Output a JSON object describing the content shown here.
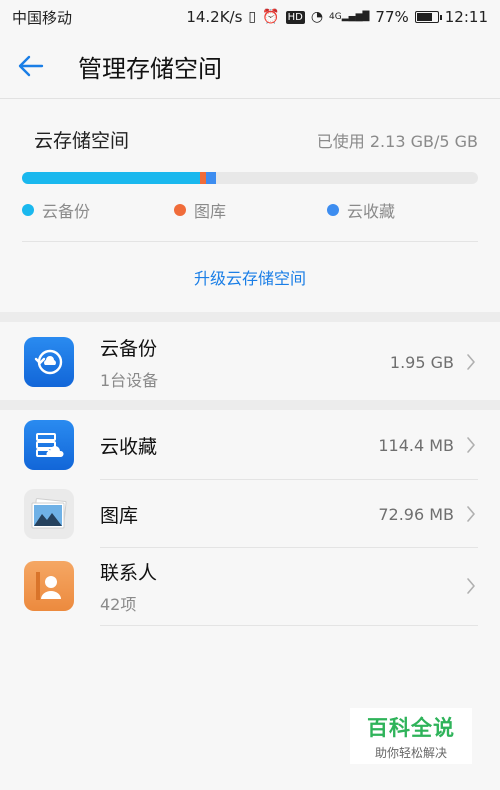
{
  "status_bar": {
    "carrier": "中国移动",
    "speed": "14.2K/s",
    "hd": "HD",
    "signal": "4G",
    "battery": "77%",
    "time": "12:11"
  },
  "header": {
    "title": "管理存储空间"
  },
  "storage": {
    "title": "云存储空间",
    "usage": "已使用 2.13 GB/5 GB",
    "used_fraction": 0.426,
    "legend": [
      {
        "label": "云备份",
        "color": "#1ab8ee"
      },
      {
        "label": "图库",
        "color": "#f06c3a"
      },
      {
        "label": "云收藏",
        "color": "#3d8df0"
      }
    ],
    "segments": [
      {
        "name": "云备份",
        "fraction": 0.39
      },
      {
        "name": "图库",
        "fraction": 0.0142
      },
      {
        "name": "云收藏",
        "fraction": 0.0223
      }
    ],
    "upgrade_label": "升级云存储空间"
  },
  "items": [
    {
      "name": "云备份",
      "sub": "1台设备",
      "size": "1.95 GB",
      "icon": "cloud-backup-icon"
    },
    {
      "name": "云收藏",
      "sub": "",
      "size": "114.4 MB",
      "icon": "cloud-favorites-icon"
    },
    {
      "name": "图库",
      "sub": "",
      "size": "72.96 MB",
      "icon": "gallery-icon"
    },
    {
      "name": "联系人",
      "sub": "42项",
      "size": "",
      "icon": "contacts-icon"
    }
  ],
  "watermark": {
    "title": "百科全说",
    "subtitle": "助你轻松解决"
  },
  "colors": {
    "accent": "#1a7ee6",
    "progress_track": "#e8e8e8"
  }
}
